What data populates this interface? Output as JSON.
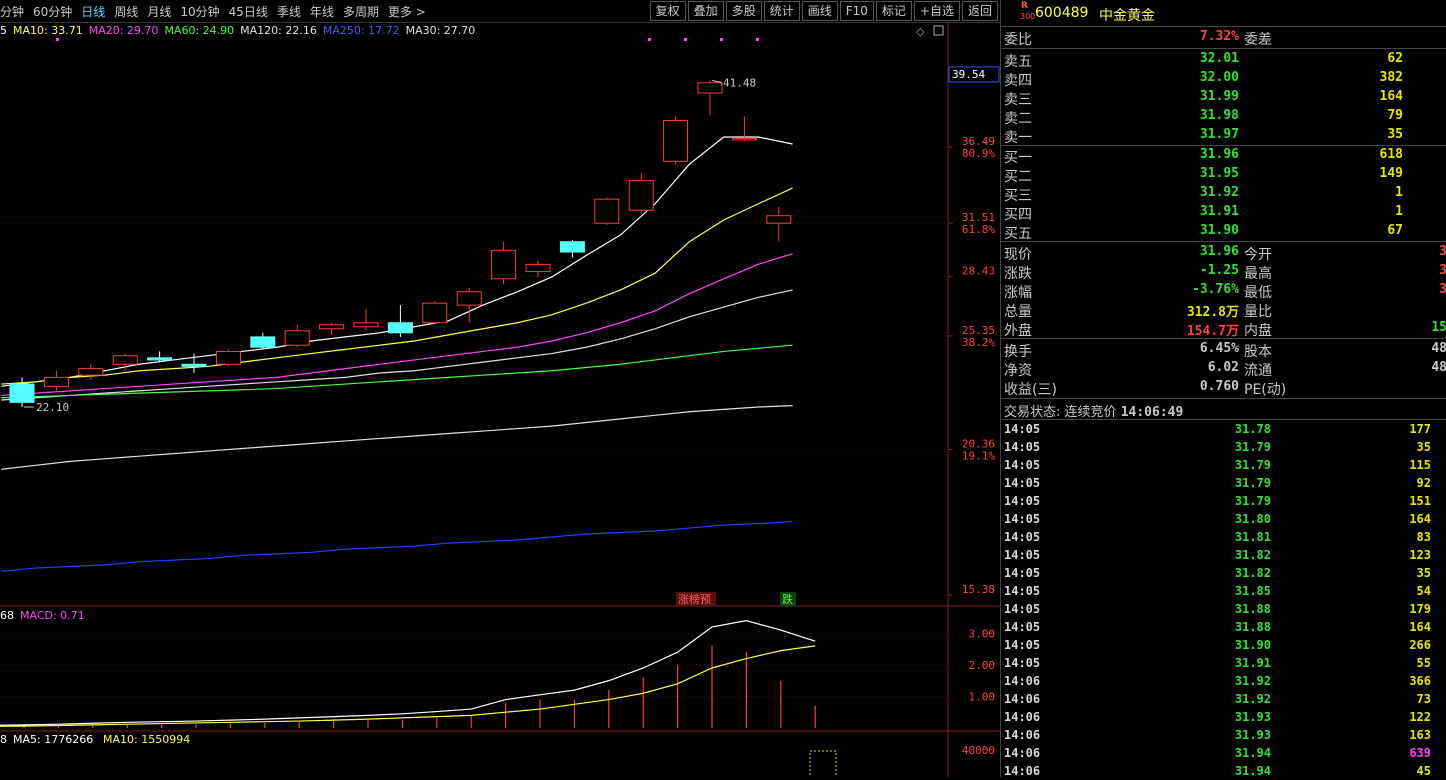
{
  "toolbar": {
    "periods": [
      "分钟",
      "60分钟",
      "日线",
      "周线",
      "月线",
      "10分钟",
      "45日线",
      "季线",
      "年线",
      "多周期",
      "更多 >"
    ],
    "active_period": "日线",
    "tools": [
      "复权",
      "叠加",
      "多股",
      "统计",
      "画线",
      "F10",
      "标记",
      "+自选",
      "返回"
    ]
  },
  "ma_legend": [
    {
      "label": "5",
      "color": "#ffffff"
    },
    {
      "label": "MA10: 33.71",
      "color": "#ffff40"
    },
    {
      "label": "MA20: 29.70",
      "color": "#ff40ff"
    },
    {
      "label": "MA60: 24.90",
      "color": "#40ff40"
    },
    {
      "label": "MA120: 22.16",
      "color": "#e0e0e0"
    },
    {
      "label": "MA250: 17.72",
      "color": "#4060ff"
    },
    {
      "label": "MA30: 27.70",
      "color": "#e0e0e0"
    }
  ],
  "price_chart": {
    "price_ticks": [
      {
        "price": 36.49,
        "pct": "80.9%"
      },
      {
        "price": 31.51,
        "pct": "61.8%"
      },
      {
        "price": 28.43,
        "pct": ""
      },
      {
        "price": 25.35,
        "pct": "38.2%"
      },
      {
        "price": 20.36,
        "pct": "19.1%"
      },
      {
        "price": 15.38,
        "pct": ""
      }
    ],
    "highlight_price": "39.54",
    "high_label": "41.48",
    "low_label": "22.10",
    "markers": [
      {
        "text": "涨榜预",
        "color": "#ff6060"
      },
      {
        "text": "跌",
        "color": "#40ff40"
      }
    ]
  },
  "macd": {
    "legend": [
      {
        "label": "68",
        "color": "#ffffff"
      },
      {
        "label": "MACD: 0.71",
        "color": "#ff40ff"
      }
    ],
    "ticks": [
      "3.00",
      "2.00",
      "1.00"
    ]
  },
  "volume": {
    "legend": [
      {
        "label": "8",
        "color": "#ffffff"
      },
      {
        "label": "MA5: 1776266",
        "color": "#ffffff"
      },
      {
        "label": "MA10: 1550994",
        "color": "#ffff40"
      }
    ],
    "tick": "40000"
  },
  "stock": {
    "badge_r": "R",
    "badge_300": "300",
    "code": "600489",
    "name": "中金黄金"
  },
  "order_ratio": {
    "label": "委比",
    "value": "7.32%",
    "label2": "委差"
  },
  "asks": [
    {
      "label": "卖五",
      "price": "32.01",
      "vol": "62"
    },
    {
      "label": "卖四",
      "price": "32.00",
      "vol": "382"
    },
    {
      "label": "卖三",
      "price": "31.99",
      "vol": "164"
    },
    {
      "label": "卖二",
      "price": "31.98",
      "vol": "79"
    },
    {
      "label": "卖一",
      "price": "31.97",
      "vol": "35"
    }
  ],
  "bids": [
    {
      "label": "买一",
      "price": "31.96",
      "vol": "618"
    },
    {
      "label": "买二",
      "price": "31.95",
      "vol": "149"
    },
    {
      "label": "买三",
      "price": "31.92",
      "vol": "1"
    },
    {
      "label": "买四",
      "price": "31.91",
      "vol": "1"
    },
    {
      "label": "买五",
      "price": "31.90",
      "vol": "67"
    }
  ],
  "quote": [
    {
      "label": "现价",
      "value": "31.96",
      "color": "green",
      "label2": "今开",
      "value2": "3"
    },
    {
      "label": "涨跌",
      "value": "-1.25",
      "color": "green",
      "label2": "最高",
      "value2": "3"
    },
    {
      "label": "涨幅",
      "value": "-3.76%",
      "color": "green",
      "label2": "最低",
      "value2": "3"
    },
    {
      "label": "总量",
      "value": "312.8万",
      "color": "yellow",
      "label2": "量比",
      "value2": ""
    },
    {
      "label": "外盘",
      "value": "154.7万",
      "color": "red",
      "label2": "内盘",
      "value2": "15"
    }
  ],
  "stats": [
    {
      "label": "换手",
      "value": "6.45%",
      "label2": "股本",
      "value2": "48"
    },
    {
      "label": "净资",
      "value": "6.02",
      "label2": "流通",
      "value2": "48"
    },
    {
      "label": "收益(三)",
      "value": "0.760",
      "label2": "PE(动)",
      "value2": ""
    }
  ],
  "trade_status": {
    "label": "交易状态:",
    "value": "连续竞价",
    "time": "14:06:49"
  },
  "trades": [
    {
      "time": "14:05",
      "price": "31.78",
      "vol": "177"
    },
    {
      "time": "14:05",
      "price": "31.79",
      "vol": "35"
    },
    {
      "time": "14:05",
      "price": "31.79",
      "vol": "115"
    },
    {
      "time": "14:05",
      "price": "31.79",
      "vol": "92"
    },
    {
      "time": "14:05",
      "price": "31.79",
      "vol": "151"
    },
    {
      "time": "14:05",
      "price": "31.80",
      "vol": "164"
    },
    {
      "time": "14:05",
      "price": "31.81",
      "vol": "83"
    },
    {
      "time": "14:05",
      "price": "31.82",
      "vol": "123"
    },
    {
      "time": "14:05",
      "price": "31.82",
      "vol": "35"
    },
    {
      "time": "14:05",
      "price": "31.85",
      "vol": "54"
    },
    {
      "time": "14:05",
      "price": "31.88",
      "vol": "179"
    },
    {
      "time": "14:05",
      "price": "31.88",
      "vol": "164"
    },
    {
      "time": "14:05",
      "price": "31.90",
      "vol": "266"
    },
    {
      "time": "14:05",
      "price": "31.91",
      "vol": "55"
    },
    {
      "time": "14:06",
      "price": "31.92",
      "vol": "366"
    },
    {
      "time": "14:06",
      "price": "31.92",
      "vol": "73"
    },
    {
      "time": "14:06",
      "price": "31.93",
      "vol": "122"
    },
    {
      "time": "14:06",
      "price": "31.93",
      "vol": "163"
    },
    {
      "time": "14:06",
      "price": "31.94",
      "vol": "639",
      "highlight": true
    },
    {
      "time": "14:06",
      "price": "31.94",
      "vol": "45"
    }
  ],
  "chart_data": {
    "type": "candlestick",
    "candles": [
      {
        "o": 23.1,
        "h": 23.4,
        "l": 22.1,
        "c": 22.3
      },
      {
        "o": 23.0,
        "h": 23.7,
        "l": 22.8,
        "c": 23.4
      },
      {
        "o": 23.5,
        "h": 24.0,
        "l": 23.3,
        "c": 23.8
      },
      {
        "o": 24.0,
        "h": 24.5,
        "l": 23.7,
        "c": 24.4
      },
      {
        "o": 24.3,
        "h": 24.6,
        "l": 24.1,
        "c": 24.2
      },
      {
        "o": 24.0,
        "h": 24.5,
        "l": 23.6,
        "c": 23.9
      },
      {
        "o": 24.0,
        "h": 24.7,
        "l": 23.9,
        "c": 24.6
      },
      {
        "o": 25.3,
        "h": 25.5,
        "l": 24.7,
        "c": 24.8
      },
      {
        "o": 24.9,
        "h": 25.9,
        "l": 24.8,
        "c": 25.6
      },
      {
        "o": 25.7,
        "h": 26.0,
        "l": 25.4,
        "c": 25.9
      },
      {
        "o": 25.8,
        "h": 26.7,
        "l": 25.6,
        "c": 26.0
      },
      {
        "o": 26.0,
        "h": 26.9,
        "l": 25.3,
        "c": 25.5
      },
      {
        "o": 26.0,
        "h": 27.1,
        "l": 25.9,
        "c": 27.0
      },
      {
        "o": 26.9,
        "h": 27.8,
        "l": 26.0,
        "c": 27.6
      },
      {
        "o": 28.3,
        "h": 30.4,
        "l": 28.0,
        "c": 29.9
      },
      {
        "o": 28.7,
        "h": 29.3,
        "l": 28.4,
        "c": 29.1
      },
      {
        "o": 30.4,
        "h": 30.5,
        "l": 29.5,
        "c": 29.8
      },
      {
        "o": 31.5,
        "h": 33.1,
        "l": 31.4,
        "c": 33.0
      },
      {
        "o": 32.3,
        "h": 34.7,
        "l": 32.1,
        "c": 34.2
      },
      {
        "o": 35.5,
        "h": 38.7,
        "l": 35.3,
        "c": 38.4
      },
      {
        "o": 40.5,
        "h": 41.48,
        "l": 38.8,
        "c": 41.3
      },
      {
        "o": 37.1,
        "h": 38.7,
        "l": 36.9,
        "c": 37.1
      },
      {
        "o": 31.5,
        "h": 32.5,
        "l": 30.4,
        "c": 31.96
      }
    ],
    "ma": [
      {
        "name": "MA5",
        "color": "#ffffff",
        "start": 0,
        "values": [
          23.0,
          23.2,
          23.4,
          23.7,
          24.0,
          24.2,
          24.4,
          24.6,
          24.8,
          25.1,
          25.3,
          25.5,
          25.8,
          26.1,
          26.9,
          27.6,
          28.4,
          29.6,
          30.8,
          32.7,
          35.3,
          37.2,
          37.2,
          36.7
        ]
      },
      {
        "name": "MA10",
        "color": "#ffff40",
        "start": 0,
        "values": [
          23.1,
          23.2,
          23.4,
          23.5,
          23.7,
          23.8,
          23.9,
          24.1,
          24.3,
          24.5,
          24.7,
          24.9,
          25.1,
          25.4,
          25.7,
          26.0,
          26.4,
          27.0,
          27.7,
          28.6,
          30.4,
          31.7,
          32.7,
          33.71
        ]
      },
      {
        "name": "MA20",
        "color": "#ff40ff",
        "start": 0,
        "values": [
          22.6,
          22.7,
          22.8,
          22.9,
          23.0,
          23.1,
          23.2,
          23.3,
          23.4,
          23.6,
          23.8,
          24.0,
          24.2,
          24.4,
          24.6,
          24.8,
          25.1,
          25.5,
          26.0,
          26.6,
          27.5,
          28.3,
          29.1,
          29.7
        ]
      },
      {
        "name": "MA30",
        "color": "#e0e0e0",
        "start": 0,
        "values": [
          22.4,
          22.5,
          22.6,
          22.7,
          22.8,
          22.9,
          23.0,
          23.1,
          23.2,
          23.3,
          23.4,
          23.6,
          23.7,
          23.9,
          24.1,
          24.3,
          24.5,
          24.8,
          25.2,
          25.7,
          26.3,
          26.8,
          27.3,
          27.7
        ]
      },
      {
        "name": "MA60",
        "color": "#40ff40",
        "start": 0,
        "values": [
          22.5,
          22.55,
          22.6,
          22.65,
          22.7,
          22.75,
          22.8,
          22.85,
          22.9,
          23.0,
          23.1,
          23.2,
          23.3,
          23.4,
          23.5,
          23.6,
          23.7,
          23.85,
          24.0,
          24.2,
          24.4,
          24.6,
          24.75,
          24.9
        ]
      },
      {
        "name": "MA120",
        "color": "#e0e0e0",
        "start": 0,
        "values": [
          19.6,
          19.75,
          19.9,
          20.0,
          20.1,
          20.2,
          20.3,
          20.4,
          20.5,
          20.6,
          20.7,
          20.8,
          20.9,
          21.0,
          21.1,
          21.2,
          21.3,
          21.45,
          21.6,
          21.75,
          21.9,
          22.0,
          22.1,
          22.16
        ]
      },
      {
        "name": "MA250",
        "color": "#2040ff",
        "start": 0,
        "values": [
          16.1,
          16.2,
          16.25,
          16.3,
          16.4,
          16.45,
          16.5,
          16.6,
          16.65,
          16.7,
          16.8,
          16.85,
          16.9,
          17.0,
          17.05,
          17.1,
          17.2,
          17.3,
          17.35,
          17.4,
          17.5,
          17.6,
          17.65,
          17.72
        ]
      }
    ],
    "macd": {
      "dif": [
        0.08,
        0.1,
        0.12,
        0.15,
        0.18,
        0.2,
        0.22,
        0.25,
        0.28,
        0.32,
        0.36,
        0.4,
        0.45,
        0.52,
        0.6,
        0.9,
        1.05,
        1.2,
        1.5,
        1.9,
        2.4,
        3.2,
        3.4,
        3.1,
        2.75
      ],
      "dea": [
        0.05,
        0.06,
        0.08,
        0.1,
        0.12,
        0.14,
        0.16,
        0.18,
        0.2,
        0.22,
        0.25,
        0.28,
        0.32,
        0.36,
        0.4,
        0.5,
        0.6,
        0.75,
        0.9,
        1.1,
        1.4,
        1.9,
        2.2,
        2.45,
        2.6
      ],
      "bars": [
        0.06,
        0.08,
        0.08,
        0.1,
        0.12,
        0.12,
        0.12,
        0.14,
        0.16,
        0.2,
        0.22,
        0.24,
        0.26,
        0.32,
        0.4,
        0.8,
        0.9,
        0.9,
        1.2,
        1.6,
        2.0,
        2.6,
        2.4,
        1.5,
        0.71
      ],
      "ylim": [
        0,
        3.8
      ]
    }
  }
}
